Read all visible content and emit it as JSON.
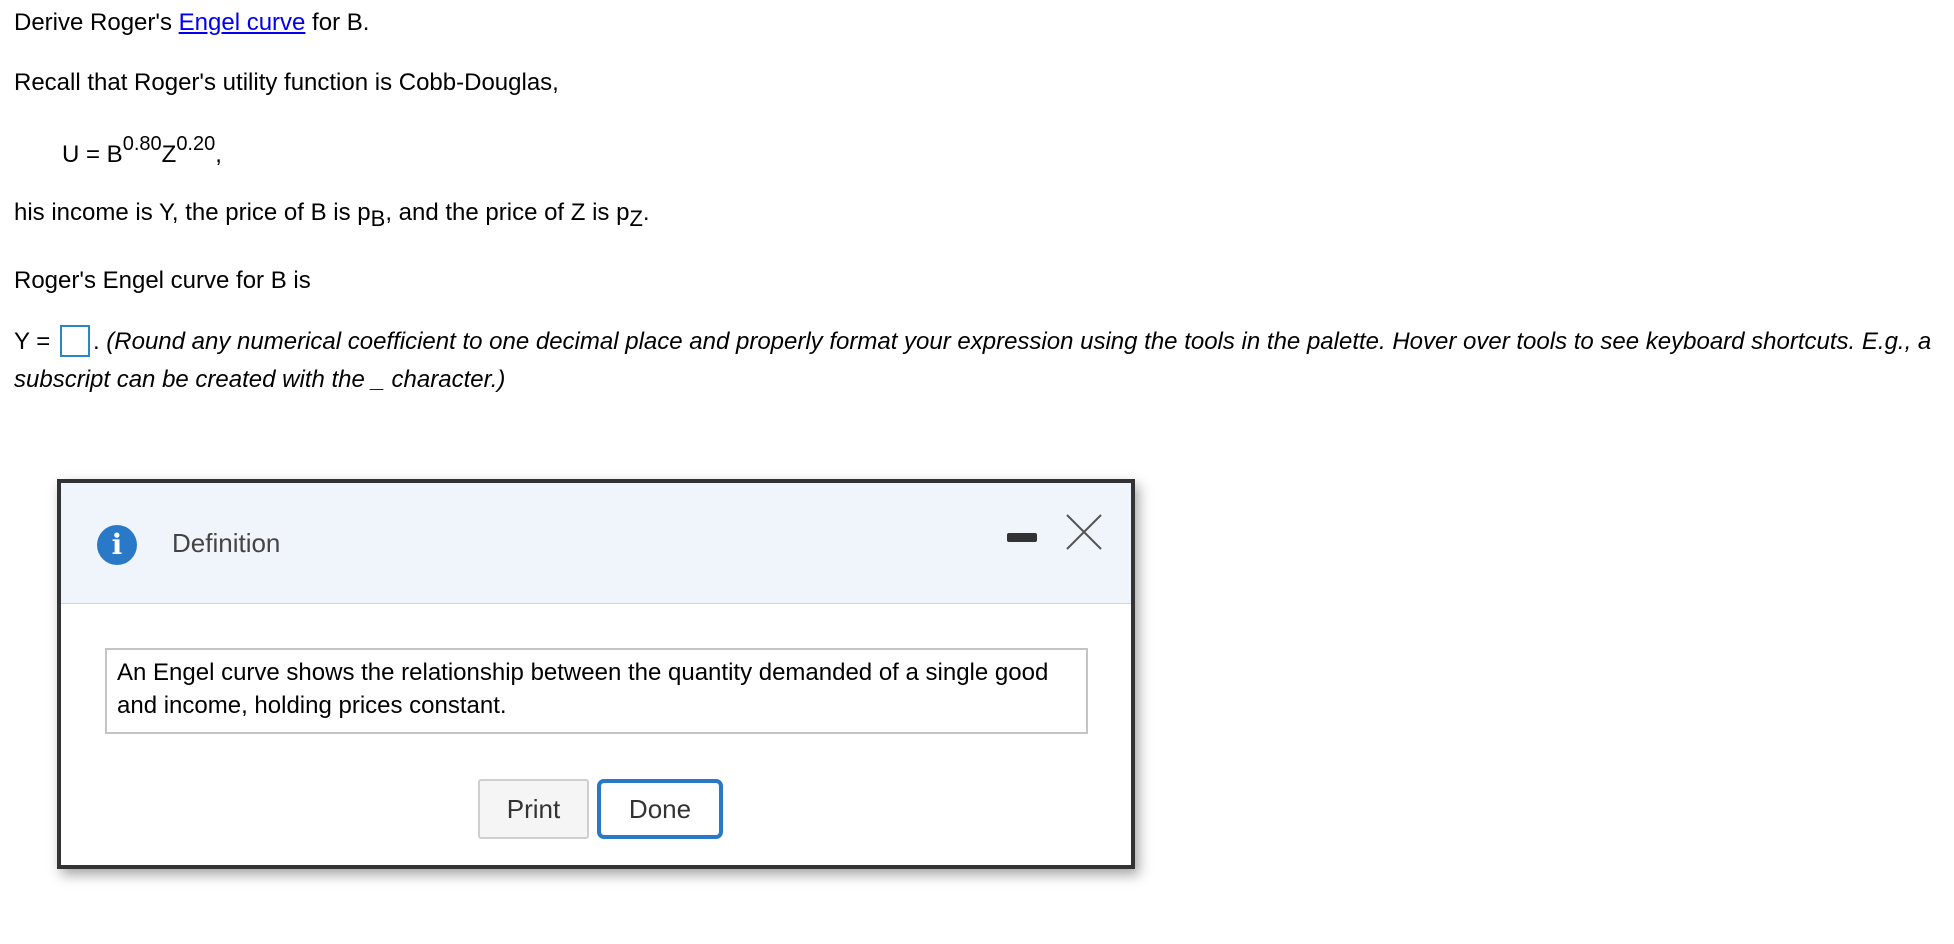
{
  "question": {
    "line1_prefix": "Derive Roger's ",
    "line1_link": "Engel curve",
    "line1_suffix": " for B.",
    "line2": "Recall that Roger's utility function is Cobb-Douglas,",
    "formula": {
      "lhs": "U = B",
      "exp_b": "0.80",
      "var_z": "Z",
      "exp_z": "0.20",
      "trail": ","
    },
    "line4": {
      "part1": "his income is Y, the price of B is p",
      "sub_b": "B",
      "part2": ", and the price of Z is p",
      "sub_z": "Z",
      "part3": "."
    },
    "line5": "Roger's Engel curve for B is",
    "answer_prefix": "Y = ",
    "answer_value": "",
    "instruction_period": ".",
    "instruction": "(Round any numerical coefficient to one decimal place and properly format your expression using the tools in the palette. Hover over tools to see keyboard shortcuts. E.g., a subscript can be created with the _ character.)"
  },
  "dialog": {
    "icon": "info-icon",
    "title": "Definition",
    "minimize_icon": "minimize-icon",
    "close_icon": "close-icon",
    "definition_text": "An Engel curve shows the relationship between the quantity demanded of a single good and income, holding prices constant.",
    "print_label": "Print",
    "done_label": "Done",
    "accent_color": "#2a78c8",
    "header_bg": "#f0f5fb"
  }
}
